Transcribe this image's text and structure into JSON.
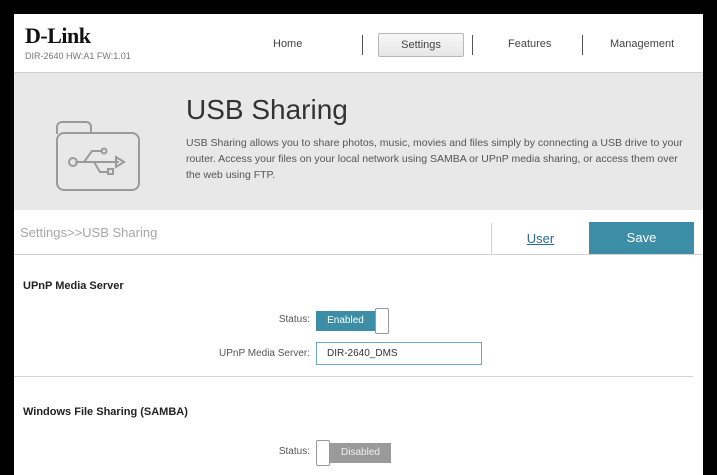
{
  "brand": {
    "logo": "D-Link",
    "model": "DIR-2640 HW:A1 FW:1.01"
  },
  "nav": {
    "home": "Home",
    "settings": "Settings",
    "features": "Features",
    "management": "Management"
  },
  "banner": {
    "title": "USB Sharing",
    "description": "USB Sharing allows you to share photos, music, movies and files simply by connecting a USB drive to your router. Access your files on your local network using SAMBA or UPnP media sharing, or access them over the web using FTP.",
    "icon": "usb-drive-icon"
  },
  "breadcrumb": "Settings>>USB Sharing",
  "actions": {
    "user": "User",
    "save": "Save"
  },
  "upnp": {
    "title": "UPnP Media Server",
    "status_label": "Status:",
    "status_value": "Enabled",
    "server_label": "UPnP Media Server:",
    "server_value": "DIR-2640_DMS"
  },
  "samba": {
    "title": "Windows File Sharing (SAMBA)",
    "status_label": "Status:",
    "status_value": "Disabled"
  },
  "colors": {
    "accent": "#3c8ea6",
    "disabled": "#9a9a9a",
    "banner_bg": "#e8e8e8"
  }
}
